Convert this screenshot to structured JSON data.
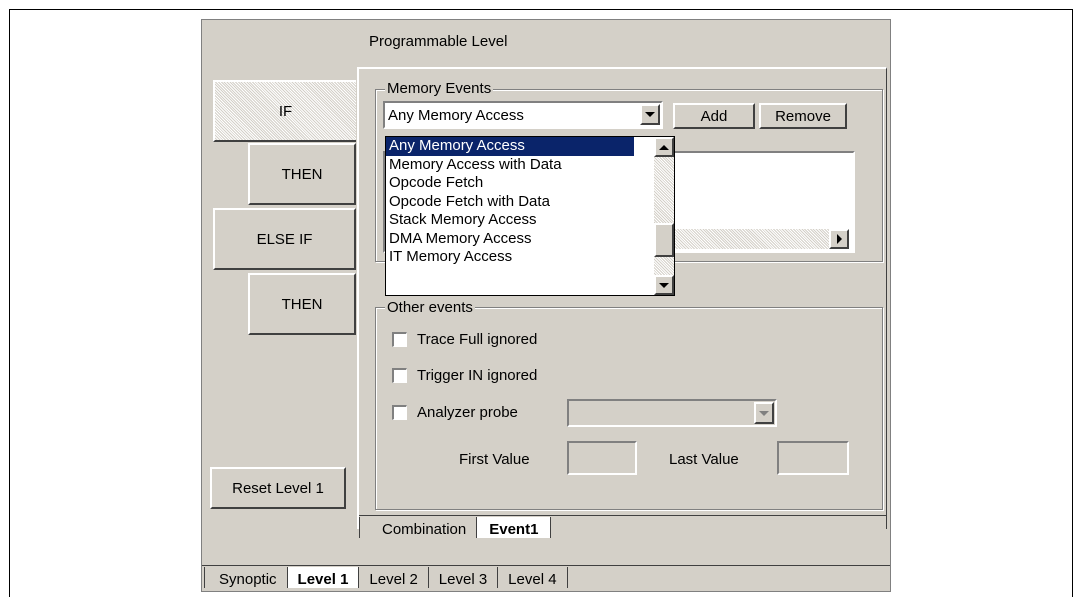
{
  "title": "Programmable Level",
  "left_buttons": {
    "if": "IF",
    "then1": "THEN",
    "else_if": "ELSE IF",
    "then2": "THEN",
    "reset": "Reset Level 1"
  },
  "memory_events": {
    "legend": "Memory Events",
    "selected": "Any Memory Access",
    "add_label": "Add",
    "remove_label": "Remove",
    "options": [
      "Any Memory Access",
      "Memory Access with Data",
      "Opcode Fetch",
      "Opcode Fetch with Data",
      "Stack Memory Access",
      "DMA Memory Access",
      "IT Memory Access"
    ]
  },
  "other_events": {
    "legend": "Other events",
    "trace_full": "Trace Full ignored",
    "trigger_in": "Trigger IN ignored",
    "analyzer_probe": "Analyzer probe",
    "first_value": "First Value",
    "last_value": "Last Value"
  },
  "inner_tabs": [
    "Combination",
    "Event1"
  ],
  "inner_active_tab": "Event1",
  "bottom_tabs": [
    "Synoptic",
    "Level 1",
    "Level 2",
    "Level 3",
    "Level 4"
  ],
  "bottom_active_tab": "Level 1",
  "colors": {
    "face": "#d4d0c8",
    "highlight": "#0a246a"
  }
}
